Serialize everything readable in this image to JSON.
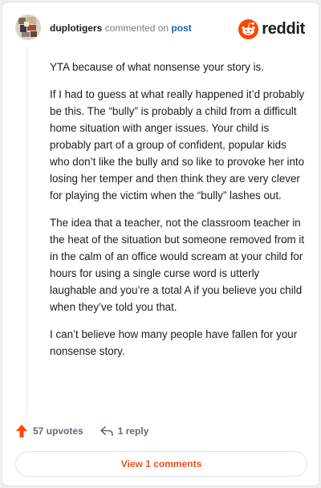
{
  "header": {
    "username": "duplotigers",
    "commented_text": "commented on",
    "post_link": "post",
    "brand": "reddit"
  },
  "comment": {
    "paragraphs": [
      "YTA because of what nonsense your story is.",
      "If I had to guess at what really happened it’d probably be this. The “bully” is probably a child from a difficult home situation with anger issues. Your child is probably part of a group of confident, popular kids who don’t like the bully and so like to provoke her into losing her temper and then think they are very clever for playing the victim when the “bully” lashes out.",
      "The idea that a teacher, not the classroom teacher in the heat of the situation but someone removed from it in the calm of an office would scream at your child for hours for using a single curse word is utterly laughable and you’re a total A if you believe you child when they’ve told you that.",
      "I can’t believe how many people have fallen for your nonsense story."
    ]
  },
  "actions": {
    "upvotes": "57 upvotes",
    "replies": "1 reply"
  },
  "footer": {
    "view_comments": "View 1 comments"
  },
  "colors": {
    "brand_orange": "#ff4500",
    "link_blue": "#2461a8",
    "accent_text": "#e8501c"
  }
}
